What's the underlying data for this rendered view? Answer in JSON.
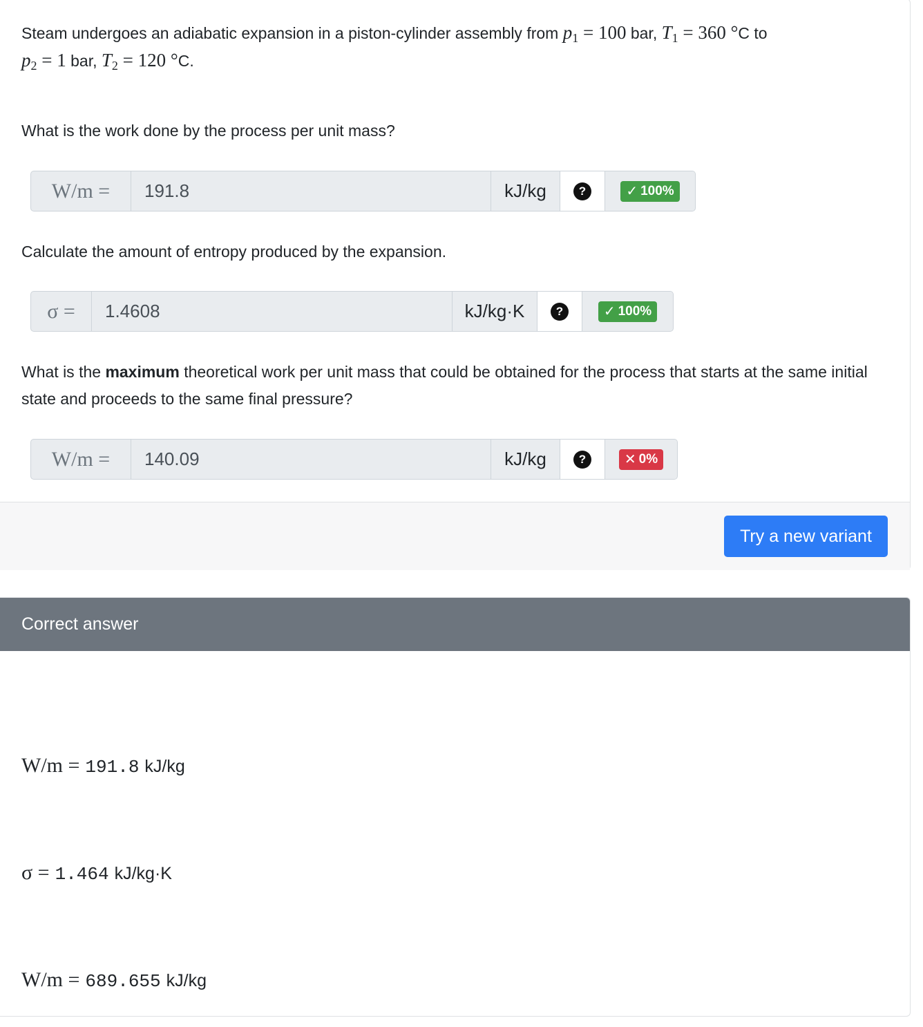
{
  "question": {
    "intro_lead": "Steam undergoes an adiabatic expansion in a piston-cylinder assembly from ",
    "p1_sym": "p",
    "p1_sub": "1",
    "p1_val": " = 100",
    "p1_unit": " bar, ",
    "T1_sym": "T",
    "T1_sub": "1",
    "T1_val": " = 360 °",
    "T1_unit": "C to",
    "p2_sym": "p",
    "p2_sub": "2",
    "p2_val": " = 1",
    "p2_unit": " bar, ",
    "T2_sym": "T",
    "T2_sub": "2",
    "T2_val": " = 120 °",
    "T2_unit": "C.",
    "q1": "What is the work done by the process per unit mass?",
    "q2": "Calculate the amount of entropy produced by the expansion.",
    "q3_pre": "What is the ",
    "q3_bold": "maximum",
    "q3_post": " theoretical work per unit mass that could be obtained for the process that starts at the same initial state and proceeds to the same final pressure?"
  },
  "inputs": [
    {
      "label": "W/m =",
      "value": "191.8",
      "unit": "kJ/kg",
      "help": "?",
      "badge": "100%",
      "badge_mark": "✓",
      "status": "correct"
    },
    {
      "label": "σ =",
      "value": "1.4608",
      "unit": "kJ/kg·K",
      "help": "?",
      "badge": "100%",
      "badge_mark": "✓",
      "status": "correct"
    },
    {
      "label": "W/m =",
      "value": "140.09",
      "unit": "kJ/kg",
      "help": "?",
      "badge": "0%",
      "badge_mark": "✕",
      "status": "incorrect"
    }
  ],
  "footer": {
    "new_variant_button": "Try a new variant"
  },
  "answer": {
    "header": "Correct answer",
    "lines": [
      {
        "lhs": "W/m =",
        "value": "191.8",
        "unit": "kJ/kg"
      },
      {
        "lhs": "σ =",
        "value": "1.464",
        "unit": "kJ/kg·K"
      },
      {
        "lhs": "W/m =",
        "value": "689.655",
        "unit": "kJ/kg"
      }
    ]
  },
  "colors": {
    "primary": "#2d7cf6",
    "success": "#43a047",
    "danger": "#d93846",
    "header_gray": "#6d757e"
  },
  "icons": {
    "help": "question-circle-icon",
    "correct": "check-icon",
    "incorrect": "x-icon"
  }
}
